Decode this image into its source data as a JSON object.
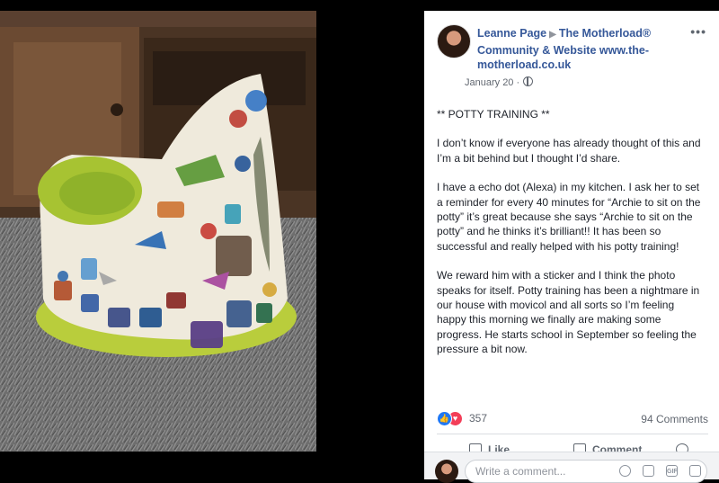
{
  "post": {
    "author": "Leanne Page",
    "group": "The Motherload® Community & Website www.the-motherload.co.uk",
    "date": "January 20",
    "privacy_icon": "globe-icon",
    "more_label": "•••",
    "paragraphs": [
      "** POTTY TRAINING **",
      "I don’t know if everyone has already thought of this and I’m a bit behind but I thought I’d share.",
      "I have a echo dot (Alexa) in my kitchen. I ask her to set a reminder for every 40 minutes for “Archie to sit on the potty” it’s great because she says “Archie to sit on the potty” and he thinks it’s brilliant!! It has been so successful and really helped with his potty training!",
      "We reward him with a sticker and I think the photo speaks for itself. Potty training has been a nightmare in our house with movicol and all sorts so I’m feeling happy this morning we finally are making some progress. He starts school in September so feeling the pressure a bit now."
    ]
  },
  "reactions": {
    "count": "357",
    "like_icon": "👍",
    "love_icon": "♥",
    "comments": "94 Comments"
  },
  "actions": {
    "like": "Like",
    "comment": "Comment",
    "share": ""
  },
  "composer": {
    "placeholder": "Write a comment...",
    "gif_label": "GIF"
  },
  "colors": {
    "link": "#365899",
    "like_blue": "#2078f4",
    "love_red": "#f33e58"
  }
}
